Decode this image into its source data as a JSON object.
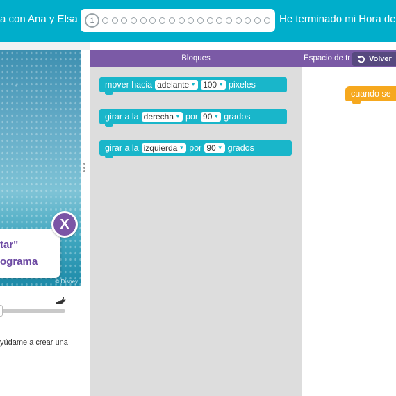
{
  "header": {
    "title": "a con Ana y Elsa",
    "current_step": "1",
    "finish_label": "He terminado mi Hora de"
  },
  "game": {
    "copyright": "© Disney",
    "bubble_line1": "tar\"",
    "bubble_line2": "ograma",
    "close_label": "X",
    "instructions": "yúdame a crear una"
  },
  "speed_slider": {
    "value": 0.0
  },
  "toolbox": {
    "label": "Bloques",
    "workspace_label": "Espacio de tr",
    "volver_label": "Volver",
    "blocks": [
      {
        "text1": "mover hacia",
        "field1": "adelante",
        "field2": "100",
        "text2": "pixeles"
      },
      {
        "text1": "girar a la",
        "field1": "derecha",
        "text2": "por",
        "field2": "90",
        "text3": "grados"
      },
      {
        "text1": "girar a la",
        "field1": "izquierda",
        "text2": "por",
        "field2": "90",
        "text3": "grados"
      }
    ]
  },
  "workspace": {
    "start_block": "cuando se"
  },
  "colors": {
    "header": "#00aecb",
    "toolbox_header": "#7b5aa6",
    "block": "#19b6ca",
    "event_block": "#f6a81e",
    "close_button": "#7b55a6"
  }
}
